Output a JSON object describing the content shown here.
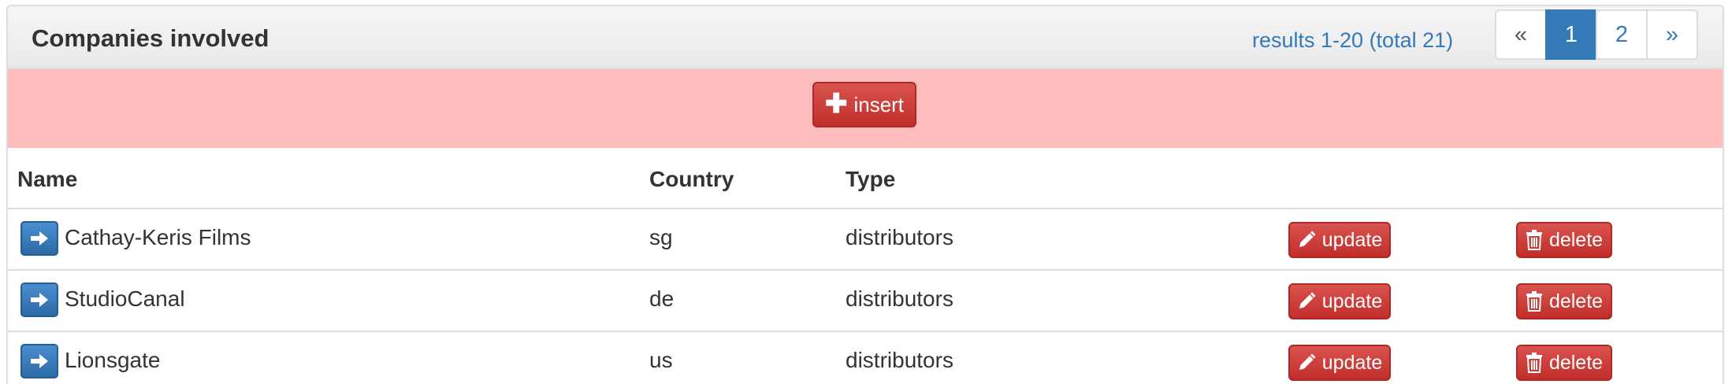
{
  "panel": {
    "title": "Companies involved"
  },
  "pagination": {
    "results_text": "results 1-20 (total 21)",
    "prev_label": "«",
    "pages": [
      "1",
      "2"
    ],
    "active_page": "1",
    "next_label": "»"
  },
  "insert": {
    "label": "insert",
    "icon": "plus-icon"
  },
  "table": {
    "headers": {
      "name": "Name",
      "country": "Country",
      "type": "Type"
    },
    "update_label": "update",
    "delete_label": "delete",
    "rows": [
      {
        "name": "Cathay-Keris Films",
        "country": "sg",
        "type": "distributors"
      },
      {
        "name": "StudioCanal",
        "country": "de",
        "type": "distributors"
      },
      {
        "name": "Lionsgate",
        "country": "us",
        "type": "distributors"
      }
    ]
  },
  "colors": {
    "primary": "#337ab7",
    "danger": "#d9534f",
    "insert_bar": "#ffbcbc"
  }
}
